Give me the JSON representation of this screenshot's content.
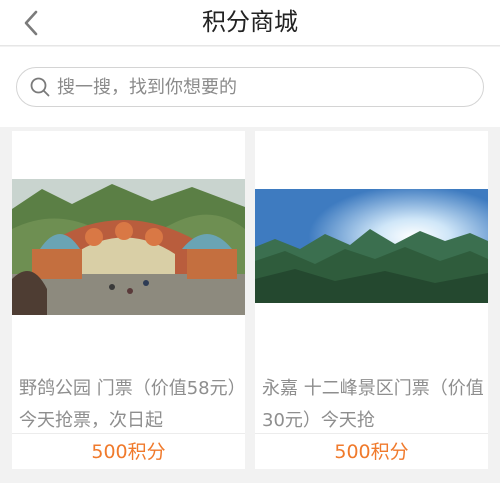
{
  "header": {
    "title": "积分商城",
    "back_icon": "chevron-left-icon"
  },
  "search": {
    "placeholder": "搜一搜，找到你想要的",
    "icon": "search-icon"
  },
  "products": [
    {
      "title": "野鸽公园 门票（价值58元）今天抢票，次日起",
      "price": "500积分",
      "image_label": "park gate"
    },
    {
      "title": "永嘉 十二峰景区门票（价值30元）今天抢",
      "price": "500积分",
      "image_label": "mountain panorama"
    }
  ],
  "colors": {
    "price": "#f07a2c",
    "title_text": "#8e8e8e",
    "background": "#f2f2f2"
  }
}
